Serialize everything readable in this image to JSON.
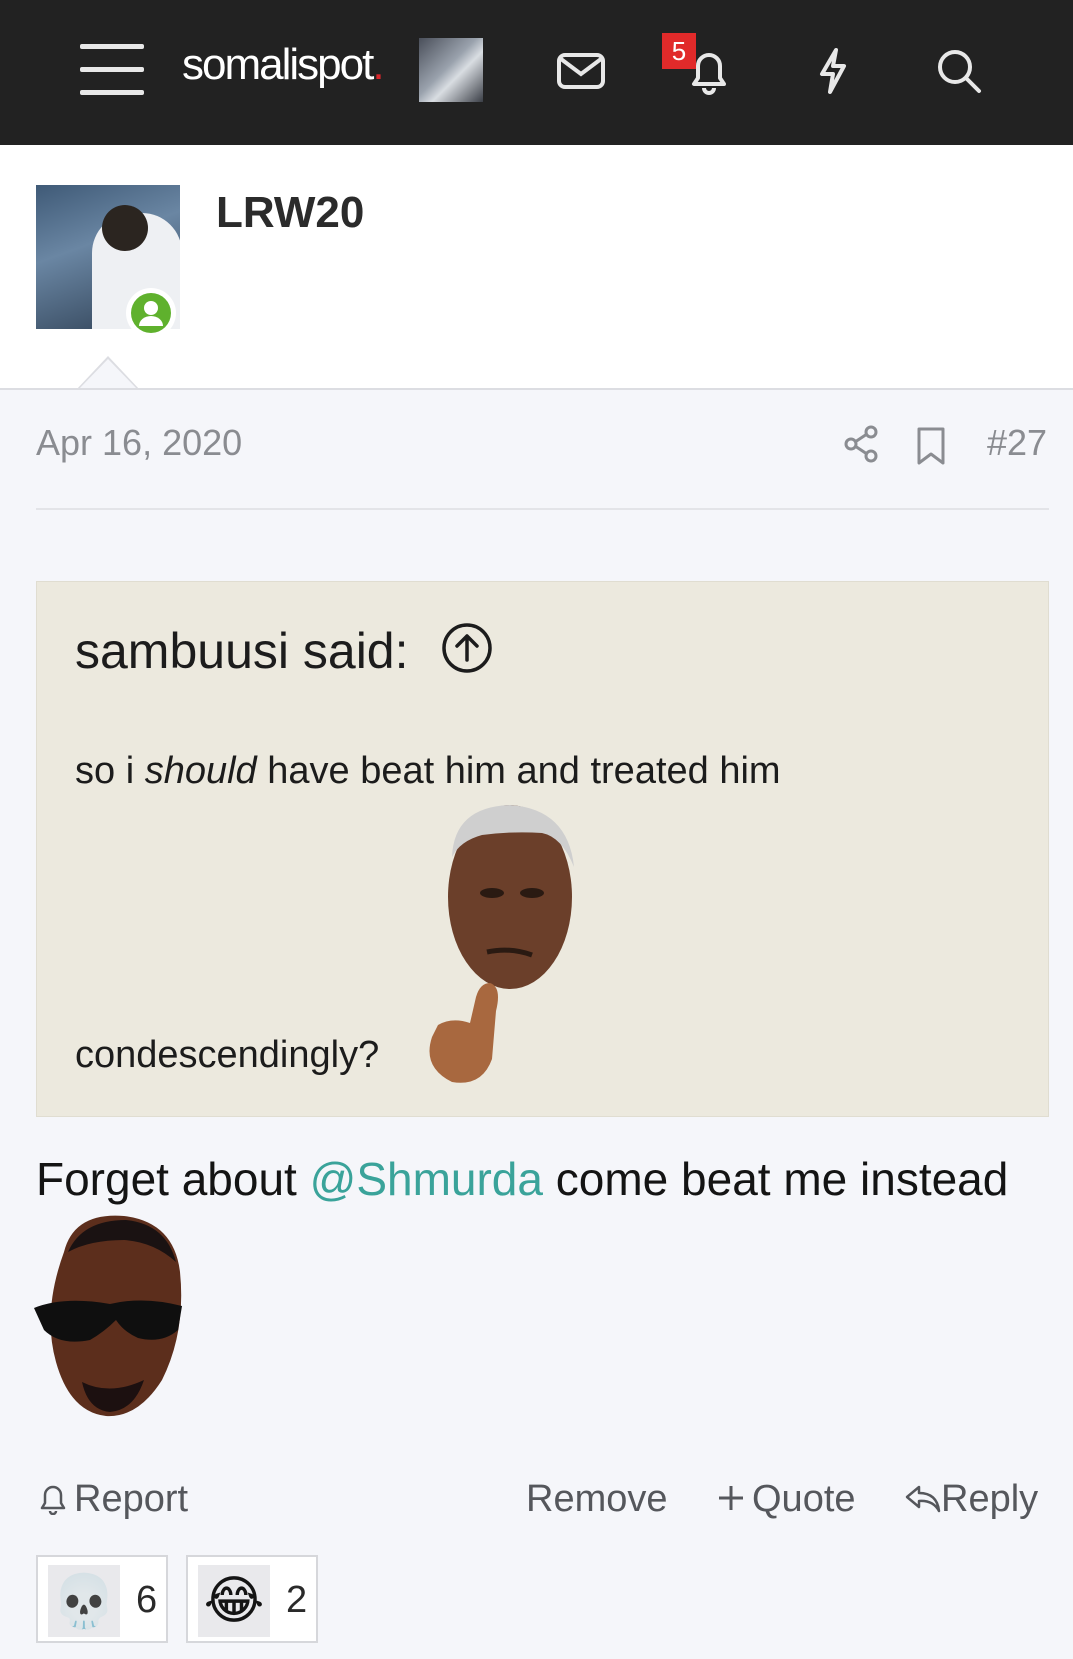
{
  "nav": {
    "logo_text": "somalispot",
    "logo_dot": ".",
    "notification_count": "5",
    "icons": [
      "menu-icon",
      "envelope-icon",
      "bell-icon",
      "bolt-icon",
      "search-icon"
    ]
  },
  "post": {
    "author": "LRW20",
    "date": "Apr 16, 2020",
    "number": "#27",
    "quote": {
      "author_label": "sambuusi said:",
      "line_prefix": "so i ",
      "line_emphasis": "should",
      "line_suffix": " have beat him and treated him",
      "line2": "condescendingly?"
    },
    "body": {
      "before": "Forget about ",
      "mention": "@Shmurda",
      "after": " come beat me instead"
    },
    "actions": {
      "report": "Report",
      "remove": "Remove",
      "quote": "Quote",
      "reply": "Reply"
    },
    "reactions": [
      {
        "icon": "skull-emoji",
        "glyph": "💀",
        "count": "6"
      },
      {
        "icon": "laughing-emoji",
        "glyph": "😂",
        "count": "2"
      }
    ]
  },
  "colors": {
    "navbar": "#222222",
    "page_bg": "#f5f6fa",
    "quote_bg": "#ece9de",
    "mention": "#3aa39a",
    "badge": "#e12a2a",
    "online": "#5fb12d"
  }
}
